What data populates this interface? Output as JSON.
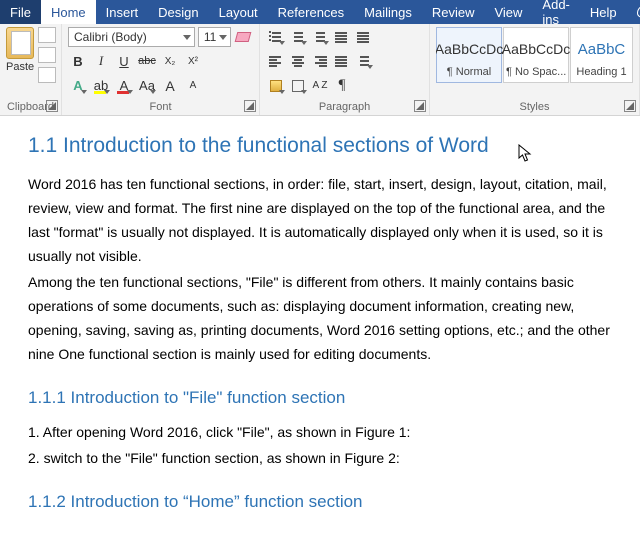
{
  "menu": {
    "file": "File",
    "home": "Home",
    "insert": "Insert",
    "design": "Design",
    "layout": "Layout",
    "references": "References",
    "mailings": "Mailings",
    "review": "Review",
    "view": "View",
    "addins": "Add-ins",
    "help": "Help",
    "tell": "Te"
  },
  "clipboard": {
    "paste": "Paste",
    "label": "Clipboard"
  },
  "font": {
    "name": "Calibri (Body)",
    "size": "11",
    "bold": "B",
    "italic": "I",
    "underline": "U",
    "strike": "abc",
    "sub": "X₂",
    "sup": "X²",
    "grow": "A",
    "shrink": "A",
    "casebtn": "Aa",
    "colorbtn": "A",
    "label": "Font"
  },
  "paragraph": {
    "label": "Paragraph",
    "pilcrow": "¶",
    "sort": "A\nZ"
  },
  "styles": {
    "label": "Styles",
    "items": [
      {
        "preview": "AaBbCcDc",
        "name": "¶ Normal",
        "selected": true,
        "heading": false
      },
      {
        "preview": "AaBbCcDc",
        "name": "¶ No Spac...",
        "selected": false,
        "heading": false
      },
      {
        "preview": "AaBbC",
        "name": "Heading 1",
        "selected": false,
        "heading": true
      }
    ]
  },
  "document": {
    "h1": "1.1 Introduction to the functional sections of Word",
    "p1": "Word 2016 has ten functional sections, in order: file, start, insert, design, layout, citation, mail, review, view and format. The first nine are displayed on the top of the functional area, and the last \"format\" is usually not displayed. It is automatically displayed only when it is used, so it is usually not visible.",
    "p2": "Among the ten functional sections, \"File\" is different from others. It mainly contains basic operations of some documents, such as: displaying document information, creating new, opening, saving, saving as, printing documents, Word 2016 setting options, etc.; and the other nine One functional section is mainly used for editing documents.",
    "h2a": "1.1.1 Introduction to \"File\" function section",
    "p3": "1. After opening Word 2016, click \"File\", as shown in Figure 1:",
    "p4": "2. switch to the \"File\" function section, as shown in Figure 2:",
    "h2b": "1.1.2 Introduction to “Home” function section"
  }
}
